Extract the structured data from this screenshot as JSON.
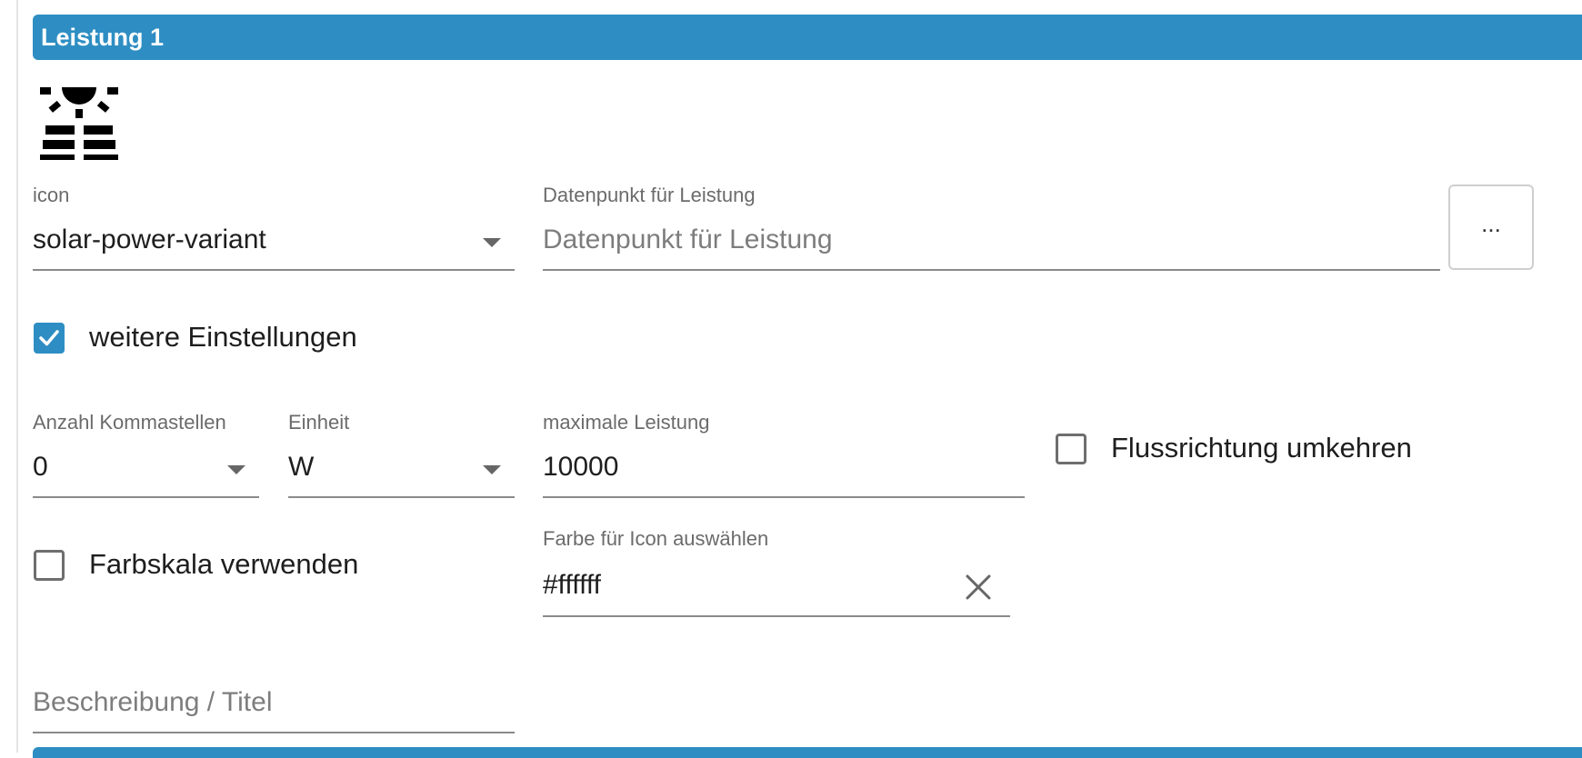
{
  "colors": {
    "accent": "#2e8ec3",
    "header_text": "#ffffff"
  },
  "header": {
    "title": "Leistung 1"
  },
  "preview_icon": {
    "name": "solar-power-variant-icon"
  },
  "icon_field": {
    "label": "icon",
    "value": "solar-power-variant"
  },
  "datapoint_field": {
    "label": "Datenpunkt für Leistung",
    "placeholder": "Datenpunkt für Leistung",
    "button_label": "..."
  },
  "more_settings": {
    "label": "weitere Einstellungen",
    "checked": true
  },
  "decimals_field": {
    "label": "Anzahl Kommastellen",
    "value": "0"
  },
  "unit_field": {
    "label": "Einheit",
    "value": "W"
  },
  "max_power_field": {
    "label": "maximale Leistung",
    "value": "10000"
  },
  "reverse_flow": {
    "label": "Flussrichtung umkehren",
    "checked": false
  },
  "color_scale": {
    "label": "Farbskala verwenden",
    "checked": false
  },
  "icon_color_field": {
    "label": "Farbe für Icon auswählen",
    "value": "#ffffff"
  },
  "description_field": {
    "placeholder": "Beschreibung / Titel"
  }
}
